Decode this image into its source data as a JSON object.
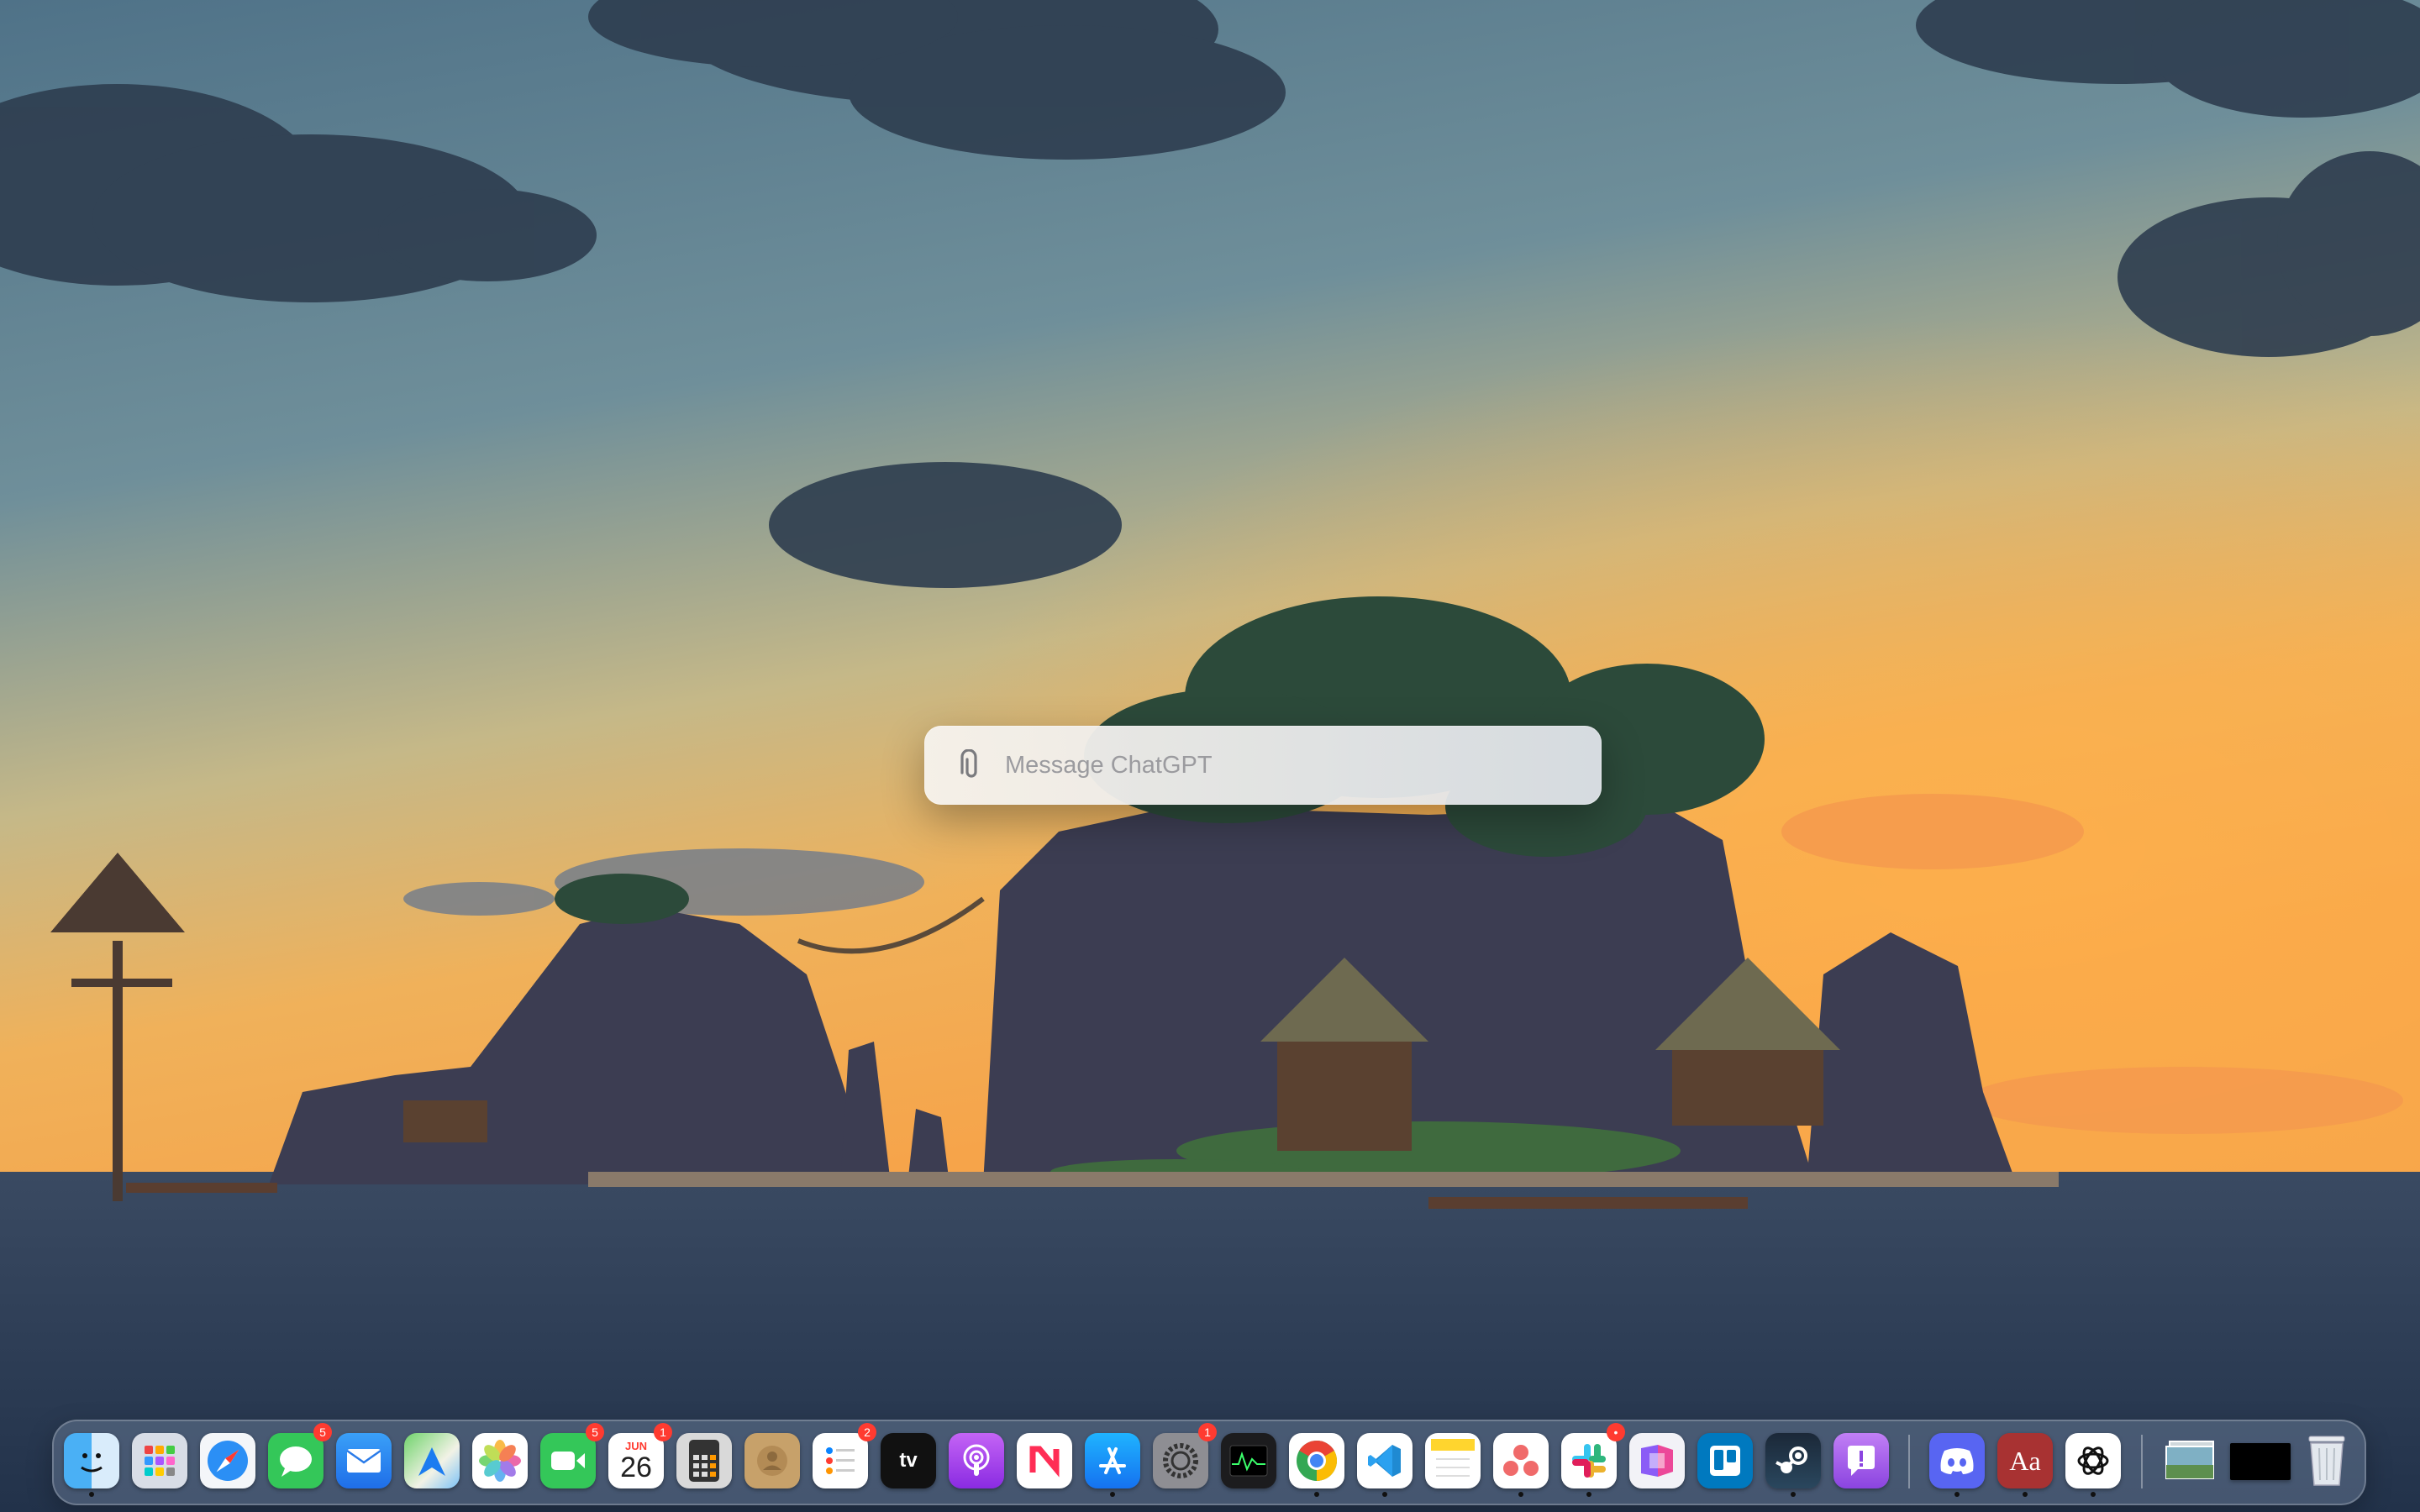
{
  "chat_bar": {
    "placeholder": "Message ChatGPT",
    "value": ""
  },
  "dock": {
    "items": [
      {
        "name": "finder",
        "icon": "finder-icon",
        "running": true
      },
      {
        "name": "launchpad",
        "icon": "launchpad-icon"
      },
      {
        "name": "safari",
        "icon": "safari-icon"
      },
      {
        "name": "messages",
        "icon": "messages-icon",
        "badge": "5"
      },
      {
        "name": "mail",
        "icon": "mail-icon"
      },
      {
        "name": "maps",
        "icon": "maps-icon"
      },
      {
        "name": "photos",
        "icon": "photos-icon"
      },
      {
        "name": "facetime",
        "icon": "facetime-icon",
        "badge": "5"
      },
      {
        "name": "calendar",
        "icon": "calendar-icon",
        "badge": "1",
        "month": "JUN",
        "day": "26"
      },
      {
        "name": "calculator",
        "icon": "calculator-icon"
      },
      {
        "name": "contacts",
        "icon": "contacts-icon"
      },
      {
        "name": "reminders",
        "icon": "reminders-icon",
        "badge": "2"
      },
      {
        "name": "apple-tv",
        "icon": "apple-tv-icon",
        "label": "tv"
      },
      {
        "name": "podcasts",
        "icon": "podcasts-icon"
      },
      {
        "name": "news",
        "icon": "news-icon"
      },
      {
        "name": "app-store",
        "icon": "app-store-icon",
        "running": true
      },
      {
        "name": "system-settings",
        "icon": "gear-icon",
        "badge": "1"
      },
      {
        "name": "activity-monitor",
        "icon": "activity-monitor-icon"
      },
      {
        "name": "chrome",
        "icon": "chrome-icon",
        "running": true
      },
      {
        "name": "vscode",
        "icon": "vscode-icon",
        "running": true
      },
      {
        "name": "notes",
        "icon": "notes-icon"
      },
      {
        "name": "asana",
        "icon": "asana-icon",
        "running": true
      },
      {
        "name": "slack",
        "icon": "slack-icon",
        "badge": "•",
        "running": true
      },
      {
        "name": "craft",
        "icon": "craft-icon"
      },
      {
        "name": "trello",
        "icon": "trello-icon"
      },
      {
        "name": "steam",
        "icon": "steam-icon",
        "running": true
      },
      {
        "name": "feedback-assistant",
        "icon": "feedback-icon"
      },
      {
        "name": "discord",
        "icon": "discord-icon",
        "running": true
      },
      {
        "name": "dictionary",
        "icon": "dictionary-icon",
        "label": "Aa",
        "running": true
      },
      {
        "name": "chatgpt",
        "icon": "chatgpt-icon",
        "running": true
      },
      {
        "name": "preview-stack",
        "icon": "image-stack-icon"
      },
      {
        "name": "black-window",
        "icon": "window-thumbnail-icon"
      },
      {
        "name": "trash",
        "icon": "trash-icon"
      }
    ]
  },
  "colors": {
    "sky_top": "#5a7f95",
    "sky_glow": "#f2b055",
    "sea": "#2b3c55",
    "badge": "#ff3b30"
  }
}
